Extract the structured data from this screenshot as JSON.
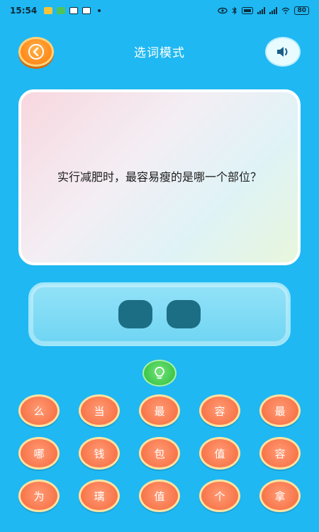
{
  "status_bar": {
    "time": "15:54",
    "app_icons": [
      {
        "name": "gallery-icon",
        "color": "#f5c43a"
      },
      {
        "name": "message-icon",
        "color": "#4fc35a"
      },
      {
        "name": "camera-icon",
        "color": "#ffffff"
      },
      {
        "name": "chat-icon",
        "color": "#ffffff"
      }
    ],
    "battery": "80"
  },
  "header": {
    "title": "选词模式"
  },
  "question": {
    "text": "实行减肥时，最容易瘦的是哪一个部位？"
  },
  "answer_slots": [
    "",
    ""
  ],
  "chars": [
    "么",
    "当",
    "最",
    "容",
    "最",
    "哪",
    "钱",
    "包",
    "值",
    "容",
    "为",
    "璃",
    "值",
    "个",
    "拿"
  ],
  "colors": {
    "background": "#1fb8f2",
    "back_button": "#ff8a1a",
    "char_button": "#f8774c",
    "hint_button": "#3cc64a",
    "answer_slot": "#1c6e84"
  }
}
